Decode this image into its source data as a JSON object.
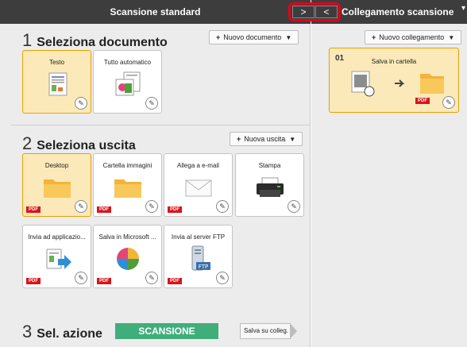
{
  "left": {
    "title": "Scansione standard",
    "nav": {
      "right_glyph": ">",
      "left_glyph": "<"
    },
    "section1": {
      "num": "1",
      "label": "Seleziona documento",
      "add_button": "Nuovo documento"
    },
    "documents": [
      {
        "label": "Testo",
        "icon": "text-document-icon",
        "selected": true
      },
      {
        "label": "Tutto automatico",
        "icon": "auto-image-icon",
        "selected": false
      }
    ],
    "section2": {
      "num": "2",
      "label": "Seleziona uscita",
      "add_button": "Nuova uscita"
    },
    "outputs": [
      {
        "label": "Desktop",
        "icon": "folder-icon",
        "badge": "PDF",
        "selected": true
      },
      {
        "label": "Cartella immagini",
        "icon": "folder-icon",
        "badge": "PDF",
        "selected": false
      },
      {
        "label": "Allega a e-mail",
        "icon": "envelope-icon",
        "badge": "PDF",
        "selected": false
      },
      {
        "label": "Stampa",
        "icon": "printer-icon",
        "badge": "",
        "selected": false
      },
      {
        "label": "Invia ad applicazio...",
        "icon": "send-to-app-icon",
        "badge": "PDF",
        "selected": false
      },
      {
        "label": "Salva in Microsoft ...",
        "icon": "microsoft-circle-icon",
        "badge": "PDF",
        "selected": false
      },
      {
        "label": "Invia al server FTP",
        "icon": "ftp-server-icon",
        "badge": "PDF",
        "selected": false
      }
    ],
    "section3": {
      "num": "3",
      "label": "Sel. azione"
    },
    "scan_button": "SCANSIONE",
    "save_link": "Salva su colleg."
  },
  "right": {
    "title": "Collegamento scansione",
    "add_button": "Nuovo collegamento",
    "link": {
      "num": "01",
      "label": "Salva in cartella",
      "badge": "PDF"
    }
  },
  "colors": {
    "header": "#3d3d3d",
    "selected_tile": "#fce9b9",
    "selected_border": "#e6a100",
    "scan": "#3fae7a",
    "pdf": "#d9141a",
    "highlight": "#e3001b"
  }
}
